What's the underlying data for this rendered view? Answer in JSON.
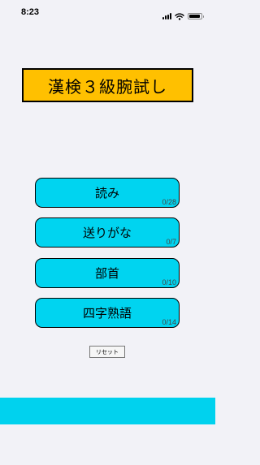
{
  "status_bar": {
    "time": "8:23"
  },
  "title": "漢検３級腕試し",
  "menu": [
    {
      "label": "読み",
      "count": "0/28"
    },
    {
      "label": "送りがな",
      "count": "0/7"
    },
    {
      "label": "部首",
      "count": "0/10"
    },
    {
      "label": "四字熟語",
      "count": "0/14"
    }
  ],
  "reset_label": "リセット",
  "colors": {
    "background": "#f2f2f7",
    "title_background": "#ffc000",
    "button_background": "#00d4f0",
    "bottom_bar": "#00d2ee"
  },
  "icons": [
    "signal-icon",
    "wifi-icon",
    "battery-icon"
  ]
}
